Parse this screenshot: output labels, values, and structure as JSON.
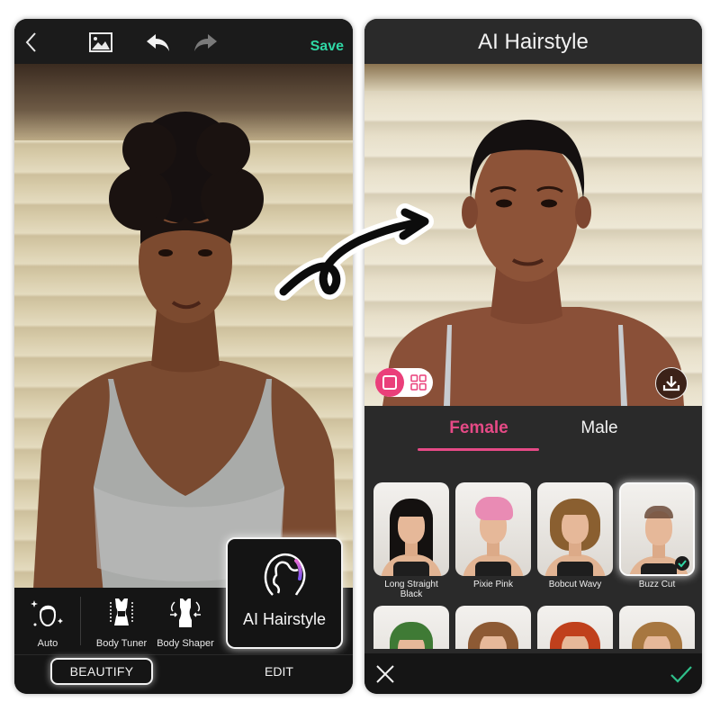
{
  "left_screen": {
    "toolbar": {
      "back_icon": "chevron-left-icon",
      "gallery_icon": "image-icon",
      "undo_icon": "undo-icon",
      "redo_icon": "redo-icon",
      "save_label": "Save"
    },
    "photo_alt": "Woman with natural curly afro hair in grey tank top",
    "tools": [
      {
        "label": "Auto",
        "icon": "face-sparkle-icon"
      },
      {
        "label": "Body Tuner",
        "icon": "body-tuner-icon"
      },
      {
        "label": "Body Shaper",
        "icon": "body-shaper-icon"
      }
    ],
    "featured_tool": {
      "label": "AI Hairstyle",
      "icon": "hairstyle-head-icon"
    },
    "bottom_tabs": [
      {
        "label": "BEAUTIFY",
        "active": true
      },
      {
        "label": "EDIT",
        "active": false
      }
    ]
  },
  "right_screen": {
    "title": "AI Hairstyle",
    "photo_alt": "Same woman with a short buzz cut hairstyle",
    "view_toggle": {
      "single_icon": "single-view-icon",
      "grid_icon": "grid-view-icon",
      "selected": "single"
    },
    "download_icon": "download-icon",
    "gender_tabs": [
      {
        "label": "Female",
        "active": true
      },
      {
        "label": "Male",
        "active": false
      }
    ],
    "styles": [
      {
        "name": "Long Straight Black",
        "hair_color": "#141110",
        "selected": false
      },
      {
        "name": "Pixie Pink",
        "hair_color": "#e98bb4",
        "selected": false
      },
      {
        "name": "Bobcut Wavy",
        "hair_color": "#8a5f30",
        "selected": false
      },
      {
        "name": "Buzz Cut",
        "hair_color": "#6b4a38",
        "selected": true
      },
      {
        "name": "",
        "hair_color": "#3f7a35",
        "selected": false
      },
      {
        "name": "",
        "hair_color": "#8d5a34",
        "selected": false
      },
      {
        "name": "",
        "hair_color": "#c0401c",
        "selected": false
      },
      {
        "name": "",
        "hair_color": "#a77740",
        "selected": false
      }
    ],
    "bottom_bar": {
      "cancel_icon": "close-icon",
      "confirm_icon": "checkmark-icon"
    }
  },
  "colors": {
    "accent_pink": "#e64a86",
    "save_green": "#2fd7a5",
    "confirm_green": "#2fbf8a"
  }
}
